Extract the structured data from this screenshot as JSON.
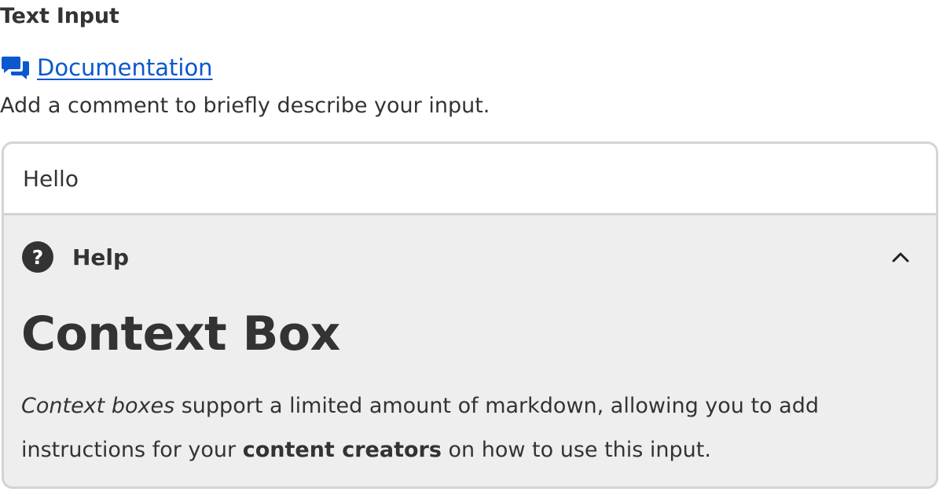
{
  "field": {
    "label": "Text Input",
    "documentation_link": "Documentation",
    "description": "Add a comment to briefly describe your input.",
    "input_value": "Hello"
  },
  "help": {
    "header_label": "Help",
    "expanded": true,
    "context_title": "Context Box",
    "body": {
      "em": "Context boxes",
      "text1": " support a limited amount of markdown, allowing you to add instructions for your ",
      "strong": "content creators",
      "text2": " on how to use this input."
    }
  },
  "icons": {
    "documentation": "chat-bubbles-icon",
    "help": "question-circle-icon",
    "collapse": "chevron-up-icon"
  },
  "colors": {
    "link": "#0b57d0",
    "text": "#333333",
    "panel_bg": "#eeeeee",
    "border": "#d4d4d4"
  }
}
